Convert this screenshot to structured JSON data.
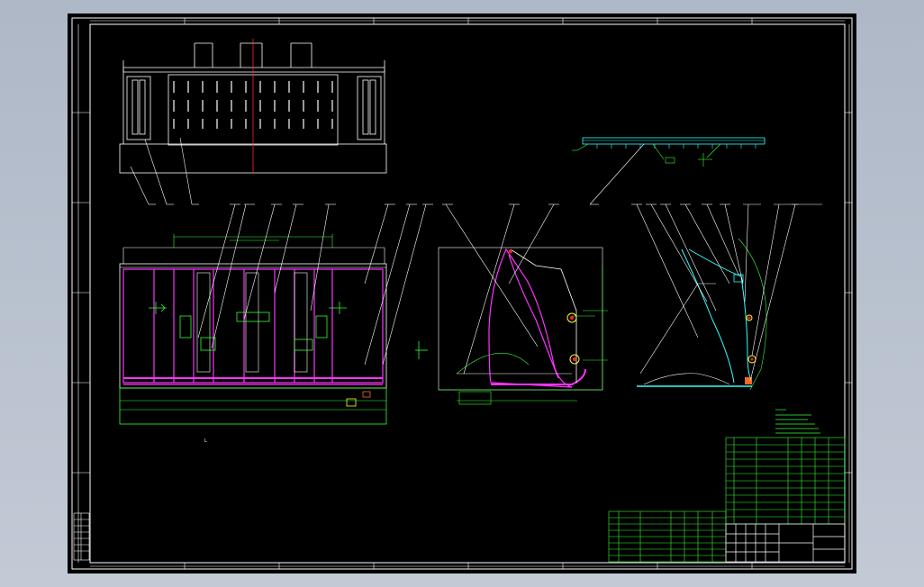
{
  "window": {
    "title": ""
  },
  "drawing": {
    "background": "#000000",
    "colors": {
      "frame": "#ffffff",
      "geometry": "#ffffff",
      "magenta": "#ff33ff",
      "green": "#33ff33",
      "cyan": "#33ffff",
      "red": "#ff2222",
      "yellow": "#ffff33"
    },
    "notes_heading": "",
    "title_block": {
      "part_name": "",
      "scale": "",
      "sheet": ""
    }
  }
}
